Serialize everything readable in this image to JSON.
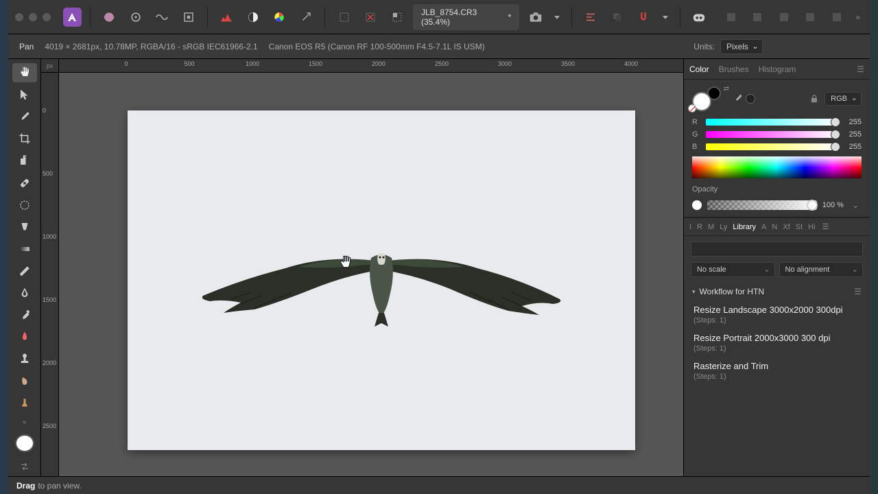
{
  "toolbar": {
    "doc_tab": "JLB_8754.CR3 (35.4%)",
    "doc_modified": "*"
  },
  "context": {
    "tool_name": "Pan",
    "dimensions": "4019 × 2681px, 10.78MP, RGBA/16 - sRGB IEC61966-2.1",
    "camera": "Canon EOS R5 (Canon RF 100-500mm F4.5-7.1L IS USM)",
    "units_label": "Units:",
    "units_value": "Pixels"
  },
  "ruler": {
    "unit_label": "px",
    "h_ticks": [
      "0",
      "500",
      "1000",
      "1500",
      "2000",
      "2500",
      "3000",
      "3500",
      "4000"
    ],
    "v_ticks": [
      "0",
      "500",
      "1000",
      "1500",
      "2000",
      "2500"
    ]
  },
  "panels": {
    "color_tabs": [
      "Color",
      "Brushes",
      "Histogram"
    ],
    "color_mode": "RGB",
    "sliders": {
      "r_label": "R",
      "r_value": "255",
      "g_label": "G",
      "g_value": "255",
      "b_label": "B",
      "b_value": "255"
    },
    "opacity_label": "Opacity",
    "opacity_value": "100 %",
    "mini_tabs": [
      "I",
      "R",
      "M",
      "Ly",
      "Library",
      "A",
      "N",
      "Xf",
      "St",
      "Hi"
    ]
  },
  "library": {
    "scale_option": "No scale",
    "align_option": "No alignment",
    "group_name": "Workflow for HTN",
    "macros": [
      {
        "title": "Resize Landscape  3000x2000 300dpi",
        "steps": "(Steps: 1)"
      },
      {
        "title": "Resize Portrait 2000x3000 300 dpi",
        "steps": "(Steps: 1)"
      },
      {
        "title": "Rasterize and Trim",
        "steps": "(Steps: 1)"
      }
    ]
  },
  "status": {
    "action": "Drag",
    "hint": "to pan view."
  }
}
